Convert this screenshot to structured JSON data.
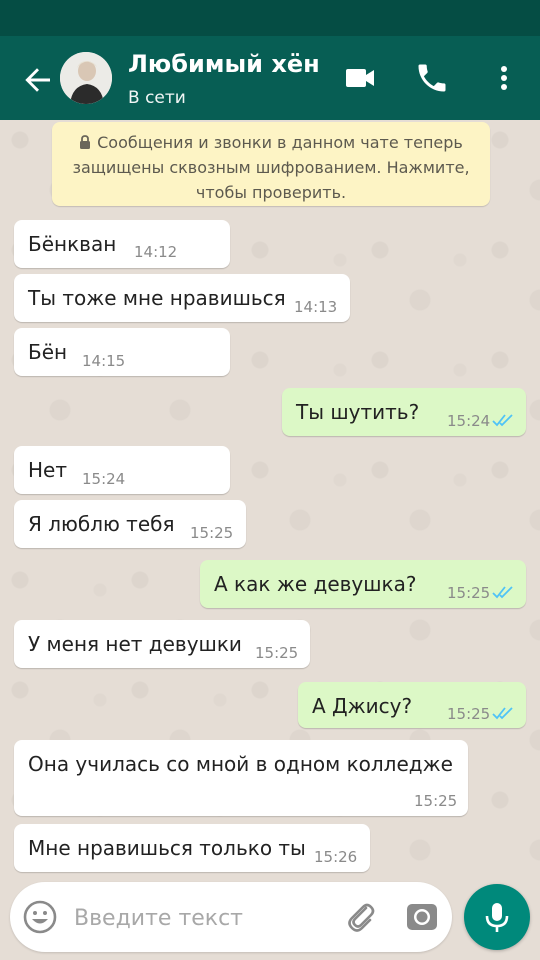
{
  "header": {
    "contact_name": "Любимый хён",
    "status": "В сети"
  },
  "icons": {
    "back": "arrow-back-icon",
    "video": "videocam-icon",
    "call": "phone-icon",
    "menu": "more-vert-icon",
    "lock": "lock-icon",
    "emoji": "emoji-icon",
    "attach": "paperclip-icon",
    "camera": "camera-icon",
    "mic": "mic-icon"
  },
  "encryption_notice": {
    "line1": "Сообщения и звонки в данном чате теперь",
    "line2": "защищены сквозным шифрованием. Нажмите,",
    "line3": "чтобы проверить."
  },
  "messages": [
    {
      "dir": "in",
      "text": "Бёнкван",
      "time": "14:12"
    },
    {
      "dir": "in",
      "text": "Ты тоже мне нравишься",
      "time": "14:13"
    },
    {
      "dir": "in",
      "text": "Бён",
      "time": "14:15"
    },
    {
      "dir": "out",
      "text": "Ты шутить?",
      "time": "15:24"
    },
    {
      "dir": "in",
      "text": "Нет",
      "time": "15:24"
    },
    {
      "dir": "in",
      "text": "Я люблю тебя",
      "time": "15:25"
    },
    {
      "dir": "out",
      "text": "А как же девушка?",
      "time": "15:25"
    },
    {
      "dir": "in",
      "text": "У меня нет девушки",
      "time": "15:25"
    },
    {
      "dir": "out",
      "text": "А Джису?",
      "time": "15:25"
    },
    {
      "dir": "in",
      "text": "Она училась со мной в одном колледже",
      "time": "15:25"
    },
    {
      "dir": "in",
      "text": "Мне нравишься только ты",
      "time": "15:26"
    }
  ],
  "composer": {
    "placeholder": "Введите текст"
  },
  "colors": {
    "header": "#075e54",
    "statusbar": "#054d44",
    "outgoing_bubble": "#dcf8c6",
    "incoming_bubble": "#ffffff",
    "read_ticks": "#4fc3f7",
    "mic_button": "#00897b"
  }
}
